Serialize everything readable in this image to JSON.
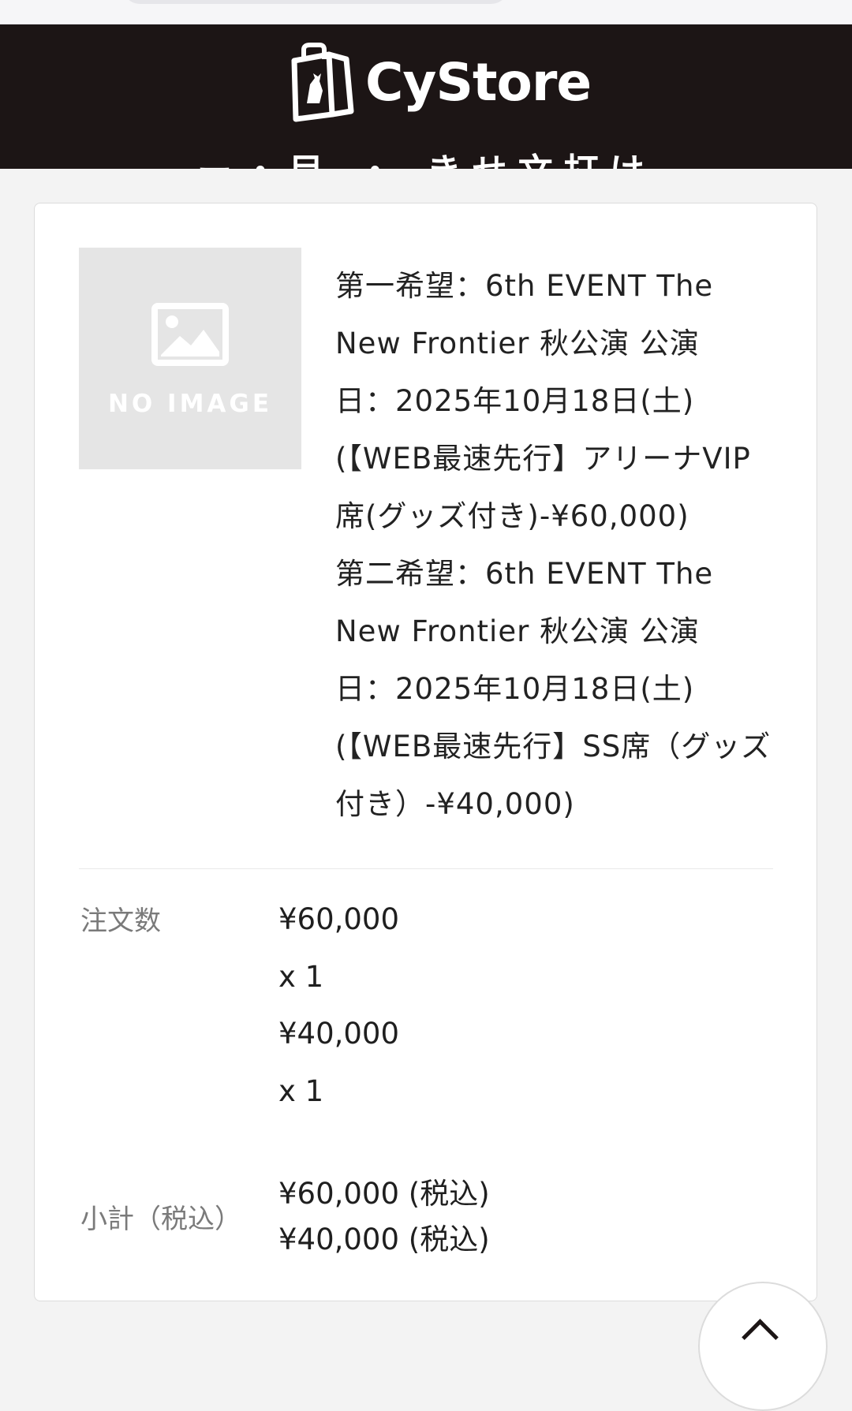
{
  "header": {
    "logo_text": "CyStore",
    "partial_title": "ー・目 ・ きせ文打け"
  },
  "product": {
    "thumbnail_label": "NO IMAGE",
    "name_lines": [
      "第一希望：6th EVENT The",
      "New Frontier 秋公演 公演",
      "日：2025年10月18日(土)",
      "(【WEB最速先行】アリーナVIP",
      "席(グッズ付き)-¥60,000)",
      "第二希望：6th EVENT The",
      "New Frontier 秋公演 公演",
      "日：2025年10月18日(土)",
      "(【WEB最速先行】SS席（グッズ",
      "付き）-¥40,000)"
    ]
  },
  "order": {
    "quantity_label": "注文数",
    "items": [
      {
        "price": "¥60,000",
        "qty": "x 1"
      },
      {
        "price": "¥40,000",
        "qty": "x 1"
      }
    ],
    "subtotal_label": "小計（税込）",
    "subtotals": [
      "¥60,000 (税込)",
      "¥40,000 (税込)"
    ]
  },
  "icons": {
    "logo": "shopping-bag-icon",
    "thumbnail": "image-placeholder-icon",
    "scroll_top": "chevron-up-icon"
  }
}
